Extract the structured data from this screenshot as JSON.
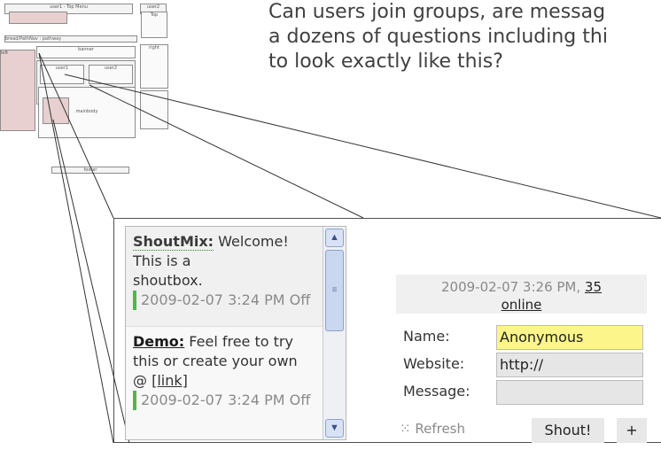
{
  "question": {
    "line1": "Can users join groups, are messag",
    "line2": "a dozens of questions including thi",
    "line3": "to look exactly like this?"
  },
  "wireframe": {
    "top_label": "user1 - Top Menu",
    "user_label": "user2",
    "side_label": "Top",
    "path_label": "bread/PathNav : pathway",
    "banner_label": "banner",
    "left_label": "left",
    "user1_label": "user1",
    "user2_label": "user2",
    "right_label": "right",
    "main_label": "mainbody",
    "footer_label": "footer"
  },
  "shoutbox": {
    "messages": [
      {
        "author": "ShoutMix:",
        "text_lines": [
          "Welcome!",
          "This is a",
          "shoutbox."
        ],
        "timestamp": "2009-02-07 3:24 PM Off"
      },
      {
        "author": "Demo:",
        "text_lines": [
          "Feel free to try",
          "this or create your own",
          "@ "
        ],
        "link": "[link]",
        "timestamp": "2009-02-07 3:24 PM Off"
      }
    ],
    "scroll_up": "▲",
    "scroll_down": "▼",
    "thumb_grip": "≡"
  },
  "form": {
    "stamp_date": "2009-02-07 3:26 PM,",
    "stamp_count": "35",
    "stamp_online": "online",
    "name_label": "Name:",
    "name_value": "Anonymous",
    "website_label": "Website:",
    "website_value": "http://",
    "message_label": "Message:",
    "message_value": "",
    "refresh_label": "Refresh",
    "shout_label": "Shout!",
    "plus_label": "+"
  },
  "colors": {
    "accent_green": "#4db84d",
    "name_highlight": "#fbf58a",
    "connector": "#333333"
  }
}
